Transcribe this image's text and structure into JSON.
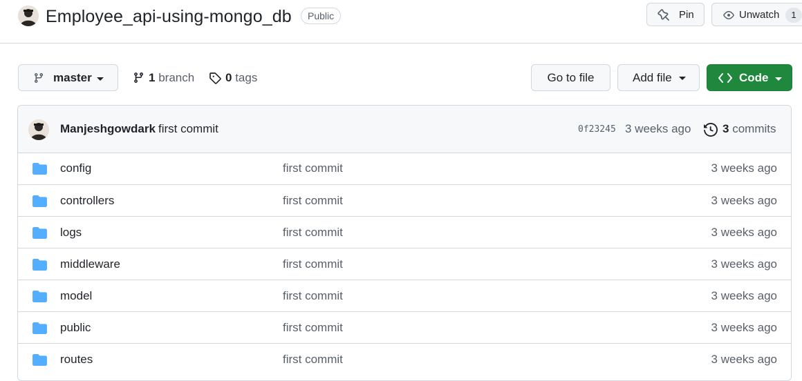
{
  "repo": {
    "name": "Employee_api-using-mongo_db",
    "visibility": "Public",
    "pin_label": "Pin",
    "watch_label": "Unwatch",
    "watch_count": "1"
  },
  "toolbar": {
    "branch": "master",
    "branch_count": "1",
    "branch_word": "branch",
    "tag_count": "0",
    "tag_word": "tags",
    "goto_label": "Go to file",
    "addfile_label": "Add file",
    "code_label": "Code"
  },
  "commit": {
    "author": "Manjeshgowdark",
    "message": "first commit",
    "sha": "0f23245",
    "time": "3 weeks ago",
    "count": "3",
    "count_word": "commits"
  },
  "files": [
    {
      "name": "config",
      "message": "first commit",
      "time": "3 weeks ago"
    },
    {
      "name": "controllers",
      "message": "first commit",
      "time": "3 weeks ago"
    },
    {
      "name": "logs",
      "message": "first commit",
      "time": "3 weeks ago"
    },
    {
      "name": "middleware",
      "message": "first commit",
      "time": "3 weeks ago"
    },
    {
      "name": "model",
      "message": "first commit",
      "time": "3 weeks ago"
    },
    {
      "name": "public",
      "message": "first commit",
      "time": "3 weeks ago"
    },
    {
      "name": "routes",
      "message": "first commit",
      "time": "3 weeks ago"
    }
  ],
  "icons": {
    "folder": "folder-icon",
    "branch": "git-branch-icon",
    "tag": "tag-icon",
    "history": "history-icon",
    "pin": "pin-icon",
    "eye": "eye-icon",
    "code": "code-icon"
  },
  "colors": {
    "folder": "#54aeff",
    "code_button": "#1f883d",
    "muted_text": "#57606a",
    "border": "#d0d7de"
  }
}
